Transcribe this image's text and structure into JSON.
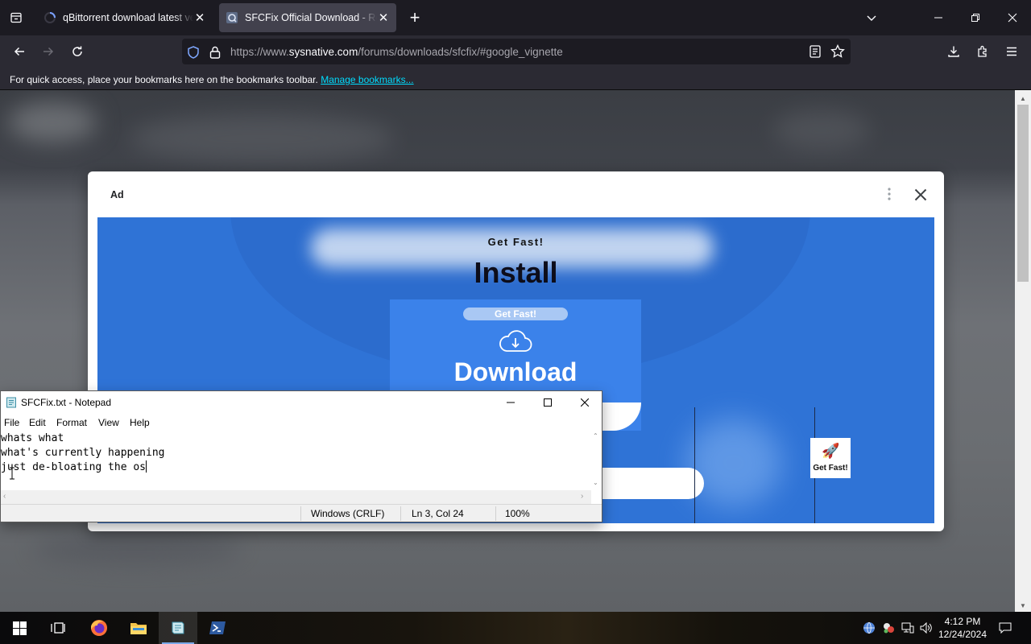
{
  "browser": {
    "tabs": [
      {
        "title": "qBittorrent download latest version"
      },
      {
        "title": "SFCFix Official Download - Reports"
      }
    ],
    "url": {
      "prefix": "https://www.",
      "domain": "sysnative.com",
      "path": "/forums/downloads/sfcfix/#google_vignette"
    },
    "bookmarks_bar": {
      "message": "For quick access, place your bookmarks here on the bookmarks toolbar.",
      "link": "Manage bookmarks..."
    }
  },
  "ad": {
    "label": "Ad",
    "brand_top": "Get Fast!",
    "headline": "Install",
    "pill": "Get Fast!",
    "button": "Download",
    "icon_label": "Get Fast!"
  },
  "notepad": {
    "title": "SFCFix.txt - Notepad",
    "menu": [
      "File",
      "Edit",
      "Format",
      "View",
      "Help"
    ],
    "lines": [
      "whats what",
      "what's currently happening",
      "just de-bloating the os"
    ],
    "status": {
      "line_ending": "Windows (CRLF)",
      "position": "Ln 3, Col 24",
      "zoom": "100%"
    }
  },
  "taskbar": {
    "clock_time": "4:12 PM",
    "clock_date": "12/24/2024"
  },
  "colors": {
    "ad_blue": "#2f73d6",
    "firefox_dark": "#1c1b22",
    "accent_link": "#00ddff"
  }
}
